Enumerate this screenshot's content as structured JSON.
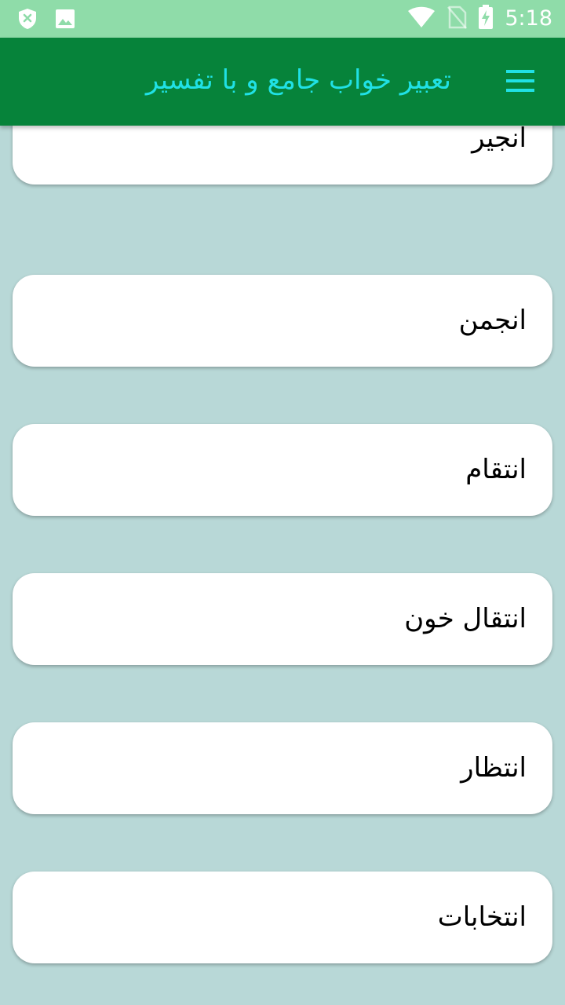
{
  "status_bar": {
    "time": "5:18",
    "left_icons": [
      "shield-x-icon",
      "image-icon"
    ],
    "right_icons": [
      "wifi-icon",
      "no-sim-icon",
      "battery-charging-icon"
    ]
  },
  "app_bar": {
    "title": "تعبیر خواب جامع و با تفسیر",
    "menu_icon": "hamburger-menu-icon",
    "background": "#06833a",
    "title_color": "#20e1e5"
  },
  "list": {
    "items": [
      {
        "label": "انجیر"
      },
      {
        "label": "انجمن"
      },
      {
        "label": "انتقام"
      },
      {
        "label": "انتقال خون"
      },
      {
        "label": "انتظار"
      },
      {
        "label": "انتخابات"
      }
    ]
  },
  "colors": {
    "status_bar": "#8fdca9",
    "background": "#b8d8d7",
    "card": "#ffffff"
  }
}
